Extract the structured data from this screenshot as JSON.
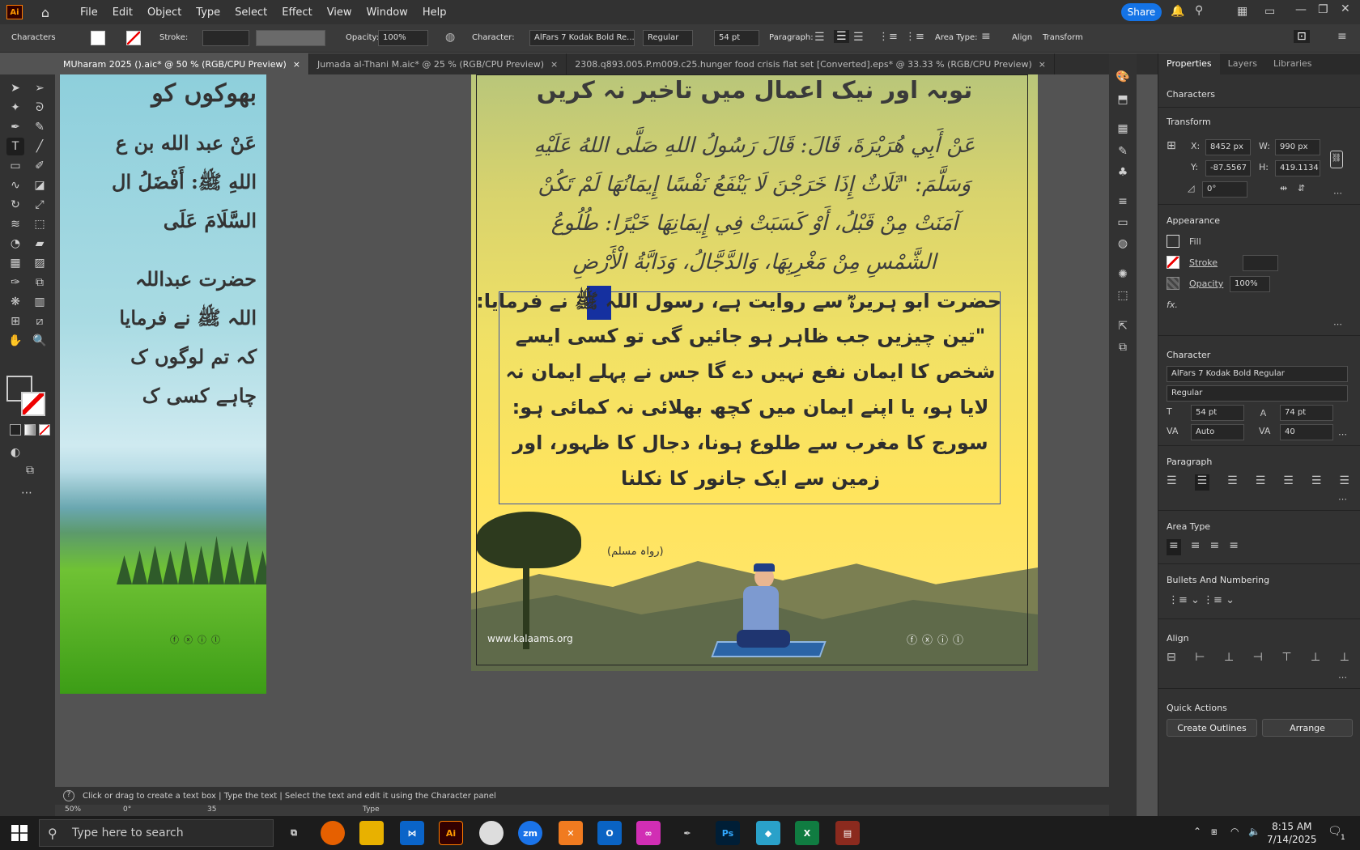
{
  "menubar": {
    "logo": "Ai",
    "items": [
      "File",
      "Edit",
      "Object",
      "Type",
      "Select",
      "Effect",
      "View",
      "Window",
      "Help"
    ],
    "share": "Share"
  },
  "control": {
    "characters": "Characters",
    "stroke_label": "Stroke:",
    "opacity_label": "Opacity:",
    "opacity_value": "100%",
    "character_label": "Character:",
    "font_name": "AlFars 7 Kodak Bold Re...",
    "font_style": "Regular",
    "font_size": "54 pt",
    "paragraph_label": "Paragraph:",
    "area_type_label": "Area Type:",
    "align": "Align",
    "transform": "Transform"
  },
  "tabs": [
    {
      "label": "MUharam 2025 ().aic* @ 50 % (RGB/CPU Preview)",
      "close": "×"
    },
    {
      "label": "Jumada al-Thani M.aic* @ 25 % (RGB/CPU Preview)",
      "close": "×"
    },
    {
      "label": "2308.q893.005.P.m009.c25.hunger food crisis flat set [Converted].eps* @ 33.33 % (RGB/CPU Preview)",
      "close": "×"
    }
  ],
  "artboard_left": {
    "lines": [
      "بھوکوں کو",
      "عَنْ عبد الله بن ع",
      "اللهِ ﷺ: أَفْضَلُ ال",
      "السَّلَامَ عَلَى",
      "حضرت عبداللہ",
      "اللہ ﷺ نے فرمایا",
      "کہ تم لوگوں ک",
      "چاہے کسی ک"
    ]
  },
  "artboard_right": {
    "heading": "توبہ اور نیک اعمال میں تاخیر نہ کریں",
    "arabic_lines": [
      "عَنْ أَبِي هُرَيْرَةَ، قَالَ: قَالَ رَسُولُ اللهِ صَلَّى اللهُ عَلَيْهِ",
      "وَسَلَّمَ: \"ثَلَاثٌ إِذَا خَرَجْنَ لَا يَنْفَعُ نَفْسًا إِيمَانُهَا لَمْ تَكُنْ",
      "آمَنَتْ مِنْ قَبْلُ، أَوْ كَسَبَتْ فِي إِيمَانِهَا خَيْرًا: طُلُوعُ",
      "الشَّمْسِ مِنْ مَغْرِبِهَا، وَالدَّجَّالُ، وَدَابَّةُ الْأَرْضِ"
    ],
    "urdu_lines": [
      "حضرت ابو ہریرہؓ سے روایت ہے، رسول اللہ ﷺ نے فرمایا:",
      "\"تین چیزیں جب ظاہر ہو جائیں گی تو کسی ایسے",
      "شخص کا ایمان نفع نہیں دے گا جس نے پہلے ایمان نہ",
      "لایا ہو، یا اپنے ایمان میں کچھ بھلائی نہ کمائی ہو:",
      "سورج کا مغرب سے طلوع ہونا، دجال کا ظہور، اور",
      "زمین سے ایک جانور کا نکلنا"
    ],
    "reference": "(رواہ مسلم)",
    "website": "www.kalaams.org"
  },
  "panel": {
    "tabs": [
      "Properties",
      "Layers",
      "Libraries"
    ],
    "characters": "Characters",
    "transform": "Transform",
    "x_label": "X:",
    "x_value": "8452 px",
    "y_label": "Y:",
    "y_value": "-87.5567 p",
    "w_label": "W:",
    "w_value": "990 px",
    "h_label": "H:",
    "h_value": "419.1134 p",
    "angle_value": "0°",
    "appearance": "Appearance",
    "fill": "Fill",
    "stroke": "Stroke",
    "opacity": "Opacity",
    "opacity_value": "100%",
    "fx": "fx.",
    "character": "Character",
    "font": "AlFars 7 Kodak Bold Regular",
    "style": "Regular",
    "size": "54 pt",
    "leading": "74 pt",
    "kerning": "Auto",
    "tracking": "40",
    "paragraph": "Paragraph",
    "area_type": "Area Type",
    "bullets": "Bullets And Numbering",
    "align": "Align",
    "quick_actions": "Quick Actions",
    "create_outlines": "Create Outlines",
    "arrange": "Arrange"
  },
  "status": {
    "hint": "Click or drag to create a text box  |  Type the text  |  Select the text and edit it using the Character panel",
    "zoom": "50%",
    "rotate": "0°",
    "page": "35",
    "tool": "Type"
  },
  "taskbar": {
    "search_placeholder": "Type here to search",
    "time": "8:15 AM",
    "date": "7/14/2025",
    "notifications": "1"
  }
}
